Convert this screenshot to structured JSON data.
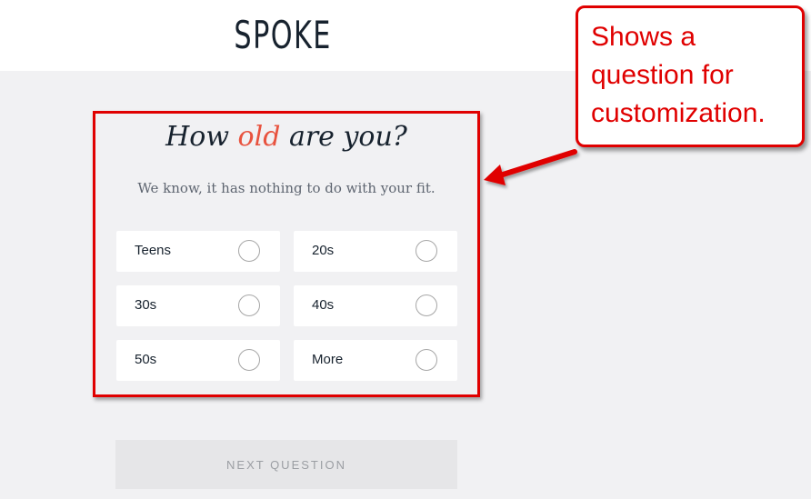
{
  "header": {
    "logo": "SPOKE"
  },
  "question": {
    "title_before": "How ",
    "title_accent": "old",
    "title_after": " are you?",
    "subtitle": "We know, it has nothing to do with your fit.",
    "options": [
      {
        "label": "Teens"
      },
      {
        "label": "20s"
      },
      {
        "label": "30s"
      },
      {
        "label": "40s"
      },
      {
        "label": "50s"
      },
      {
        "label": "More"
      }
    ]
  },
  "next_button": {
    "label": "NEXT QUESTION"
  },
  "annotation": {
    "lines": [
      "Shows a",
      "question for",
      "customization."
    ],
    "color": "#e00000"
  },
  "colors": {
    "brand_dark": "#17222e",
    "accent": "#e8533f",
    "background": "#f1f1f3"
  }
}
